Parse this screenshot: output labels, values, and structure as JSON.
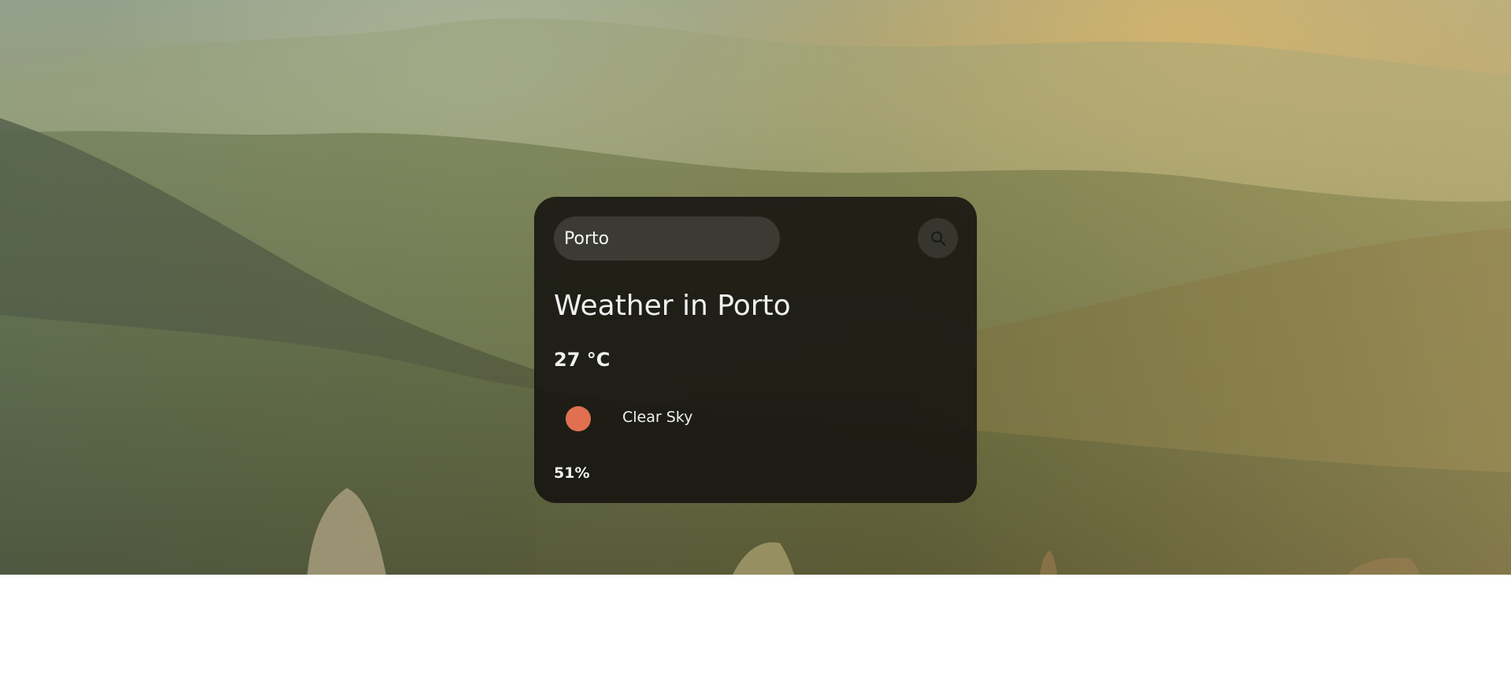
{
  "search": {
    "value": "Porto",
    "placeholder": ""
  },
  "search_button": {
    "icon": "search-icon"
  },
  "weather": {
    "title": "Weather in Porto",
    "temperature": "27 °C",
    "condition": "Clear Sky",
    "condition_icon": "sun-icon",
    "humidity": "51%"
  },
  "colors": {
    "card_background": "#12100e",
    "sun": "#e07050",
    "text": "#f0f0f0",
    "page_background": "#ffffff"
  }
}
